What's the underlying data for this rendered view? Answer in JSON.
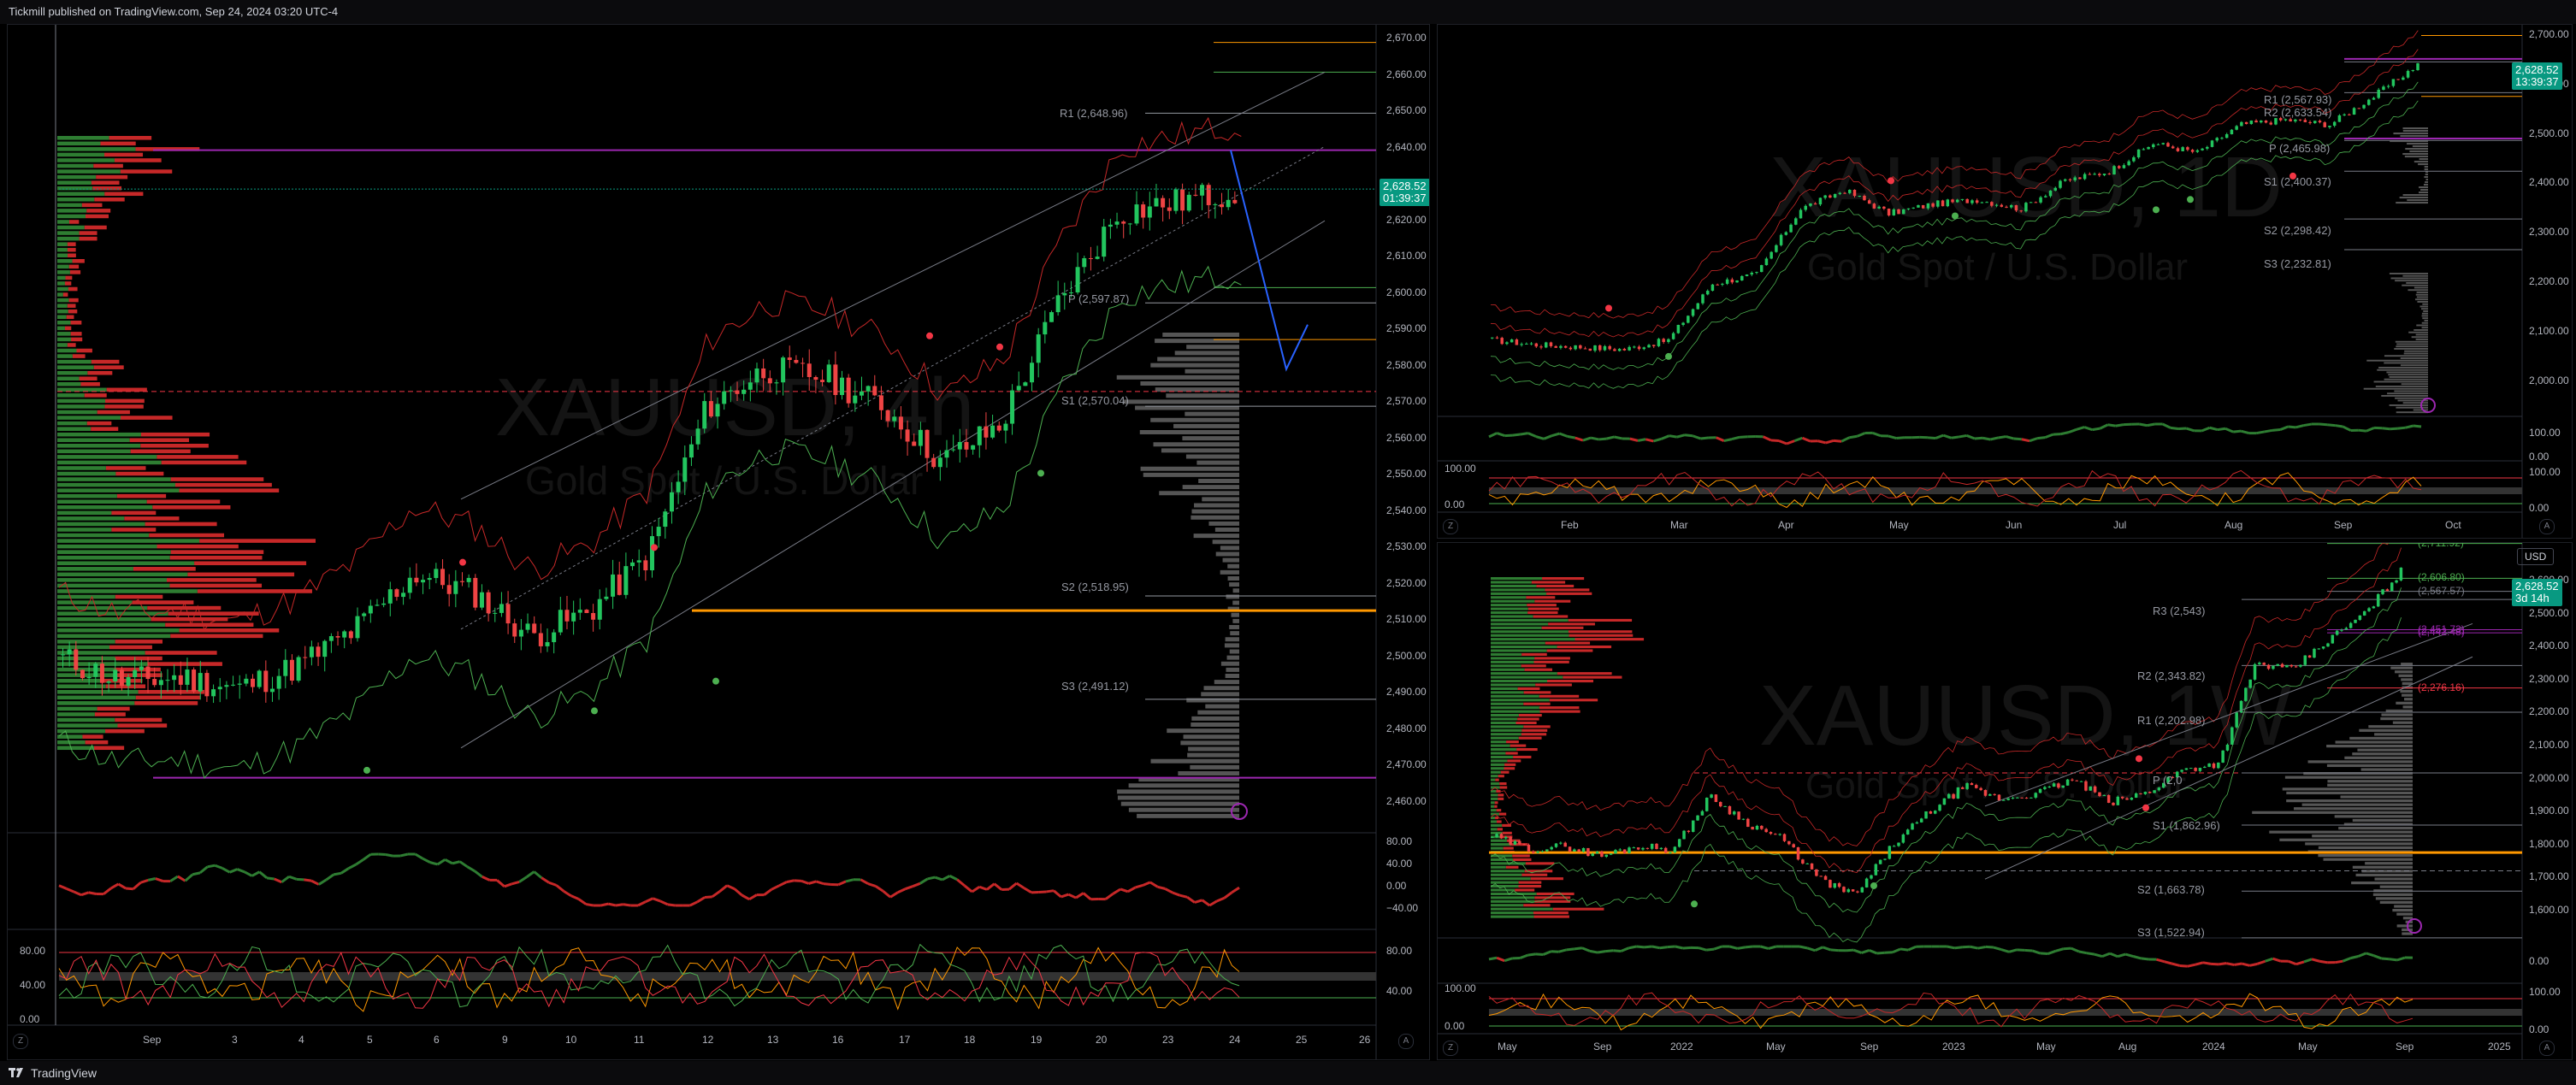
{
  "header": {
    "published": "Tickmill published on TradingView.com, Sep 24, 2024 03:20 UTC-4"
  },
  "footer": {
    "brand": "TradingView"
  },
  "colors": {
    "bull": "#089981",
    "bear": "#f23645",
    "green_candle": "#22c55e",
    "red_candle": "#ef4444",
    "price_badge": "#089981",
    "purple": "#9c27b0",
    "orange": "#ff9800"
  },
  "left": {
    "symbol": "XAUUSD, 4h",
    "desc": "Gold Spot / U.S. Dollar",
    "price": "2,628.52",
    "countdown": "01:39:37",
    "y_ticks": [
      "2,670.00",
      "2,660.00",
      "2,650.00",
      "2,640.00",
      "2,630.00",
      "2,620.00",
      "2,610.00",
      "2,600.00",
      "2,590.00",
      "2,580.00",
      "2,570.00",
      "2,560.00",
      "2,550.00",
      "2,540.00",
      "2,530.00",
      "2,520.00",
      "2,510.00",
      "2,500.00",
      "2,490.00",
      "2,480.00",
      "2,470.00",
      "2,460.00"
    ],
    "pivots": {
      "r1": "R1 (2,648.96)",
      "p": "P (2,597.87)",
      "s1": "S1 (2,570.04)",
      "s2": "S2 (2,518.95)",
      "s3": "S3 (2,491.12)"
    },
    "rsi_ticks": [
      "80.00",
      "40.00",
      "0.00",
      "−40.00"
    ],
    "stoch_ticks": [
      "80.00",
      "40.00"
    ],
    "stoch_left_ticks": [
      "80.00",
      "40.00",
      "0.00"
    ],
    "x_ticks": [
      "Sep",
      "3",
      "4",
      "5",
      "6",
      "9",
      "10",
      "11",
      "12",
      "13",
      "16",
      "17",
      "18",
      "19",
      "20",
      "23",
      "24",
      "25",
      "26"
    ]
  },
  "top_right": {
    "symbol": "XAUUSD, 1D",
    "desc": "Gold Spot / U.S. Dollar",
    "price": "2,628.52",
    "countdown": "13:39:37",
    "y_ticks": [
      "2,700.00",
      "2,600.00",
      "2,500.00",
      "2,400.00",
      "2,300.00",
      "2,200.00",
      "2,100.00",
      "2,000.00"
    ],
    "pivots": {
      "r2": "R2 (2,633.54)",
      "r1": "R1 (2,567.93)",
      "p": "P (2,465.98)",
      "s1": "S1 (2,400.37)",
      "s2": "S2 (2,298.42)",
      "s3": "S3 (2,232.81)"
    },
    "rsi_ticks": [
      "100.00",
      "0.00"
    ],
    "stoch_ticks": [
      "100.00",
      "0.00"
    ],
    "stoch_left_ticks": [
      "100.00",
      "0.00"
    ],
    "x_ticks": [
      "Feb",
      "Mar",
      "Apr",
      "May",
      "Jun",
      "Jul",
      "Aug",
      "Sep",
      "Oct"
    ]
  },
  "bottom_right": {
    "symbol": "XAUUSD, 1W",
    "desc": "Gold Spot / U.S. Dollar",
    "currency": "USD",
    "price": "2,628.52",
    "countdown": "3d 14h",
    "y_ticks": [
      "2,600.00",
      "2,500.00",
      "2,400.00",
      "2,300.00",
      "2,200.00",
      "2,100.00",
      "2,000.00",
      "1,900.00",
      "1,800.00",
      "1,700.00",
      "1,600.00"
    ],
    "pivots": {
      "r3": "R3 (2,543)",
      "r2": "R2 (2,343.82)",
      "r1": "R1 (2,202.98)",
      "p": "P (2,0",
      "s1": "S1 (1,862.96)",
      "s2": "S2 (1,663.78)",
      "s3": "S3 (1,522.94)"
    },
    "level_labels": [
      "(2,711.92)",
      "(2,606.80)",
      "(2,567.57)",
      "(2,451.73)",
      "(2,442.48)",
      "(2,276.16)"
    ],
    "rsi_ticks": [
      "0.00"
    ],
    "stoch_ticks": [
      "100.00",
      "0.00"
    ],
    "stoch_left_ticks": [
      "100.00",
      "0.00"
    ],
    "x_ticks": [
      "May",
      "Sep",
      "2022",
      "May",
      "Sep",
      "2023",
      "May",
      "Aug",
      "2024",
      "May",
      "Sep",
      "2025"
    ]
  }
}
